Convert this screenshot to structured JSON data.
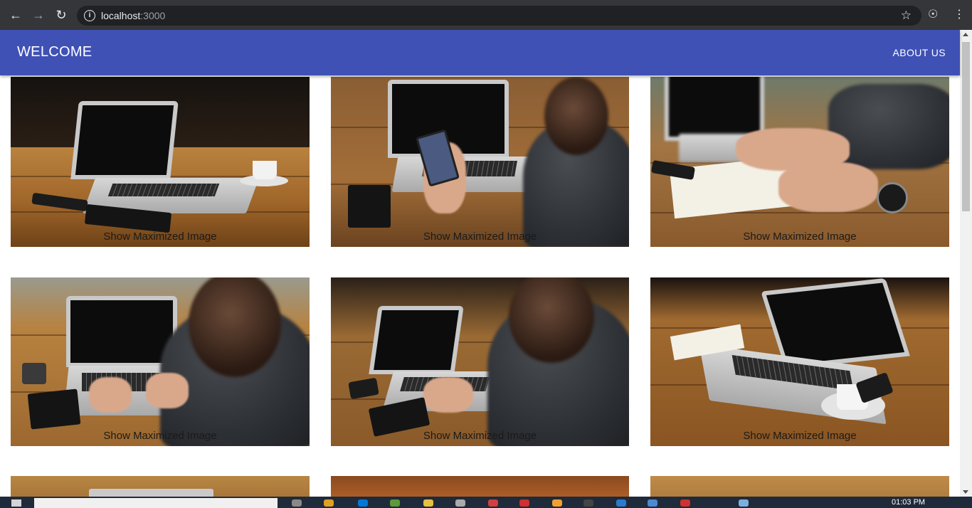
{
  "browser": {
    "url_host": "localhost",
    "url_port": ":3000"
  },
  "app_bar": {
    "title": "WELCOME",
    "about_label": "ABOUT US",
    "color": "#3f51b5"
  },
  "gallery": {
    "caption": "Show Maximized Image",
    "cards": [
      {
        "caption": "Show Maximized Image",
        "selected": false
      },
      {
        "caption": "Show Maximized Image",
        "selected": true
      },
      {
        "caption": "Show Maximized Image",
        "selected": false
      },
      {
        "caption": "Show Maximized Image",
        "selected": false
      },
      {
        "caption": "Show Maximized Image",
        "selected": false
      },
      {
        "caption": "Show Maximized Image",
        "selected": false
      }
    ]
  },
  "taskbar": {
    "clock": "01:03 PM"
  }
}
